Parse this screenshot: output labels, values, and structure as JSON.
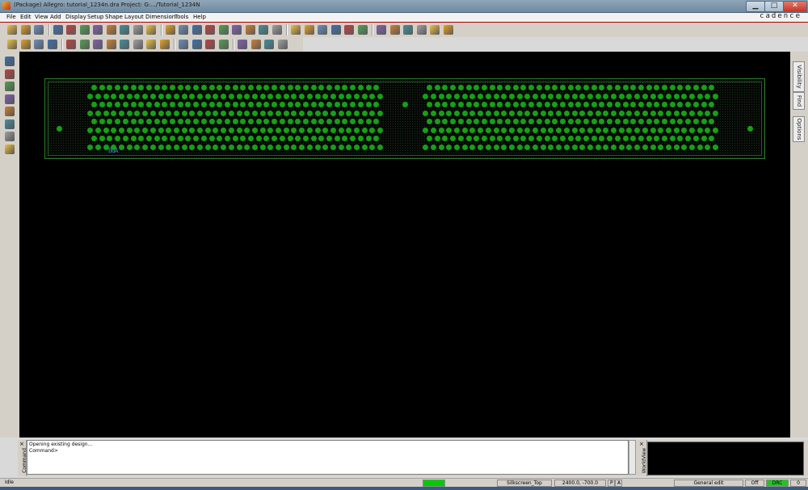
{
  "window": {
    "title": "(Package) Allegro: tutorial_1234n.dra  Project: G:.../Tutorial_1234N",
    "minimize_icon": "minimize-icon",
    "maximize_icon": "maximize-icon",
    "close_icon": "close-icon"
  },
  "menu": {
    "items": [
      "File",
      "Edit",
      "View",
      "Add",
      "Display",
      "Setup",
      "Shape",
      "Layout",
      "Dimension",
      "Tools",
      "Help"
    ]
  },
  "brand": {
    "logo_text": "cadence"
  },
  "toolbar": {
    "row1_icons": [
      "new-icon",
      "open-icon",
      "save-icon",
      "move-icon",
      "copy-icon",
      "delete-icon",
      "undo-icon",
      "redo-icon",
      "fix-icon",
      "unfix-icon",
      "pin-icon",
      "zoom-points-icon",
      "zoom-fit-icon",
      "zoom-in-icon",
      "zoom-out-icon",
      "zoom-world-icon",
      "zoom-previous-icon",
      "zoom-center-icon",
      "redraw-icon",
      "3d-view-icon",
      "grid-icon",
      "color-icon",
      "shadow-icon",
      "layer-visibility-icon",
      "unrats-icon",
      "show-element-icon",
      "assign-color-icon",
      "measure-icon",
      "drc-icon",
      "wirebond-icon",
      "refresh-icon",
      "report-icon"
    ],
    "row2_icons": [
      "die-icon",
      "substrate-icon",
      "layer-icon",
      "bga-icon",
      "pin-array-icon",
      "stack-icon",
      "circle-pin-icon",
      "square-pin-icon",
      "via-icon",
      "bond-finger-icon",
      "ring-icon",
      "shape-icon",
      "fill-icon",
      "route-icon",
      "spacing-icon",
      "width-icon",
      "ratsnest-icon",
      "copy-view-icon",
      "compare-icon",
      "help-icon"
    ]
  },
  "left_toolbar": {
    "icons": [
      "add-connect-icon",
      "slide-icon",
      "delay-tune-icon",
      "custom-smooth-icon",
      "add-line-icon",
      "add-rectangle-icon",
      "wirebond-add-icon",
      "wirebond-edit-icon"
    ]
  },
  "canvas": {
    "background": "#000000",
    "pad_color": "#15a015",
    "outline_color": "#2e7a2e",
    "refdes_text": "BGA"
  },
  "side_tabs": [
    "Visibility",
    "Find",
    "Options"
  ],
  "command": {
    "panel_label": "Command",
    "lines": [
      "Opening existing design...",
      "Command>"
    ]
  },
  "worldview": {
    "panel_label": "WorldView"
  },
  "status": {
    "state": "Idle",
    "state_indicator_color": "#00cc00",
    "active_class": "Silkscreen_Top",
    "coordinates": "2400.0, -700.0",
    "coord_mode": "P",
    "abs_mode": "A",
    "edit_mode": "General edit",
    "off_label": "Off",
    "drc_label": "DRC",
    "drc_color": "#22c422",
    "count": "0"
  }
}
